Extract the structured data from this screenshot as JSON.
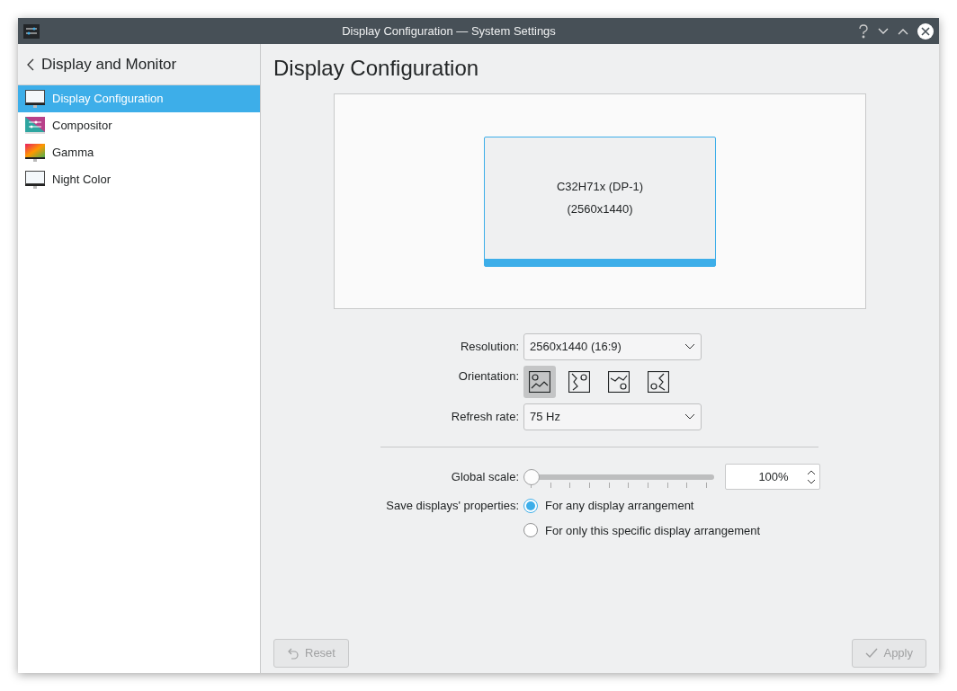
{
  "window": {
    "title": "Display Configuration — System Settings"
  },
  "sidebar": {
    "back_title": "Display and Monitor",
    "items": [
      {
        "label": "Display Configuration",
        "selected": true,
        "kind": "display"
      },
      {
        "label": "Compositor",
        "selected": false,
        "kind": "compositor"
      },
      {
        "label": "Gamma",
        "selected": false,
        "kind": "gamma"
      },
      {
        "label": "Night Color",
        "selected": false,
        "kind": "display"
      }
    ]
  },
  "page": {
    "title": "Display Configuration",
    "monitor": {
      "name": "C32H71x (DP-1)",
      "resolution": "(2560x1440)",
      "selected": true
    },
    "resolution": {
      "label": "Resolution:",
      "value": "2560x1440 (16:9)"
    },
    "orientation": {
      "label": "Orientation:",
      "options": [
        {
          "kind": "landscape",
          "selected": true
        },
        {
          "kind": "left",
          "selected": false
        },
        {
          "kind": "inverted",
          "selected": false
        },
        {
          "kind": "right",
          "selected": false
        }
      ]
    },
    "refresh_rate": {
      "label": "Refresh rate:",
      "value": "75 Hz"
    },
    "global_scale": {
      "label": "Global scale:",
      "level": 0,
      "value": "100%"
    },
    "save_properties": {
      "label": "Save displays' properties:",
      "options": [
        {
          "label": "For any display arrangement",
          "selected": true
        },
        {
          "label": "For only this specific display arrangement",
          "selected": false
        }
      ]
    }
  },
  "buttons": [
    {
      "kind": "reset",
      "label": "Reset",
      "disabled": true
    },
    {
      "kind": "apply",
      "label": "Apply",
      "disabled": true
    }
  ]
}
